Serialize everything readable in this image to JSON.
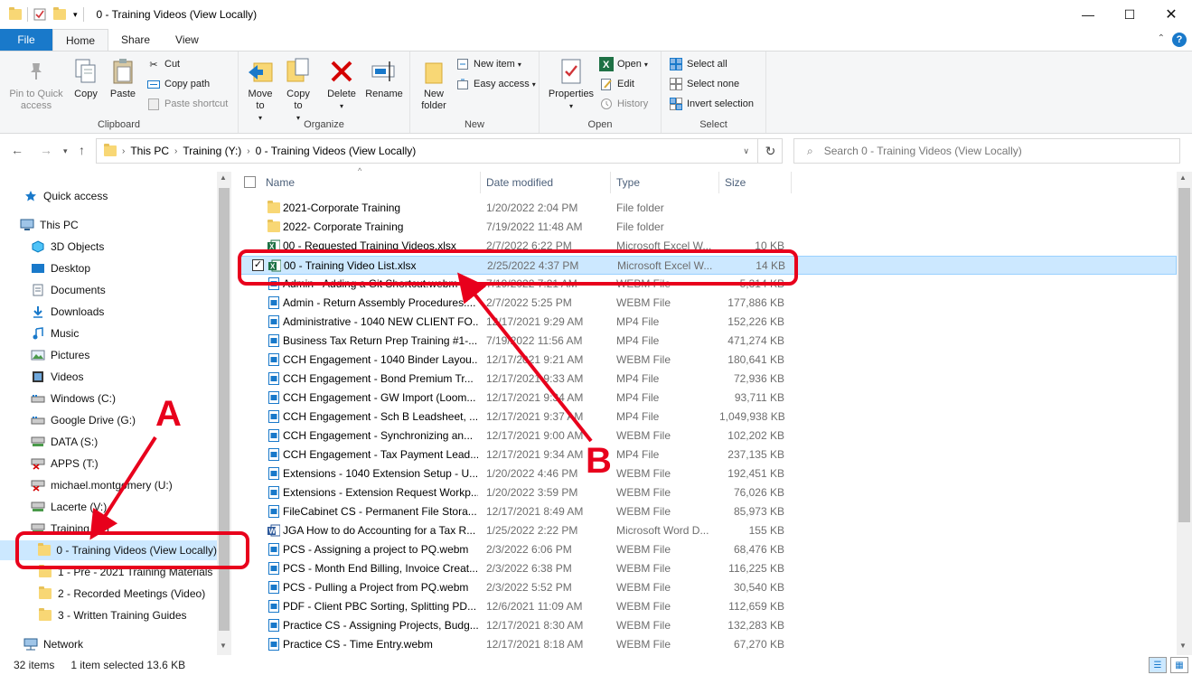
{
  "window": {
    "title": "0 - Training Videos (View Locally)",
    "minimize_icon": "minimize-icon",
    "maximize_icon": "maximize-icon",
    "close_icon": "close-icon"
  },
  "ribbon_tabs": [
    "File",
    "Home",
    "Share",
    "View"
  ],
  "ribbon": {
    "clipboard": {
      "label": "Clipboard",
      "pin": "Pin to Quick access",
      "copy": "Copy",
      "paste": "Paste",
      "cut": "Cut",
      "copy_path": "Copy path",
      "paste_shortcut": "Paste shortcut"
    },
    "organize": {
      "label": "Organize",
      "move_to": "Move to",
      "copy_to": "Copy to",
      "delete": "Delete",
      "rename": "Rename"
    },
    "new": {
      "label": "New",
      "new_folder": "New folder",
      "new_item": "New item",
      "easy_access": "Easy access"
    },
    "open": {
      "label": "Open",
      "properties": "Properties",
      "open": "Open",
      "edit": "Edit",
      "history": "History"
    },
    "select": {
      "label": "Select",
      "select_all": "Select all",
      "select_none": "Select none",
      "invert_selection": "Invert selection"
    }
  },
  "address": {
    "segments": [
      "This PC",
      "Training (Y:)",
      "0 - Training Videos (View Locally)"
    ],
    "search_placeholder": "Search 0 - Training Videos (View Locally)"
  },
  "nav": {
    "items": [
      {
        "label": "Quick access",
        "icon": "star-icon"
      },
      {
        "label": "This PC",
        "icon": "computer-icon"
      },
      {
        "label": "3D Objects",
        "icon": "cube-icon"
      },
      {
        "label": "Desktop",
        "icon": "desktop-icon"
      },
      {
        "label": "Documents",
        "icon": "documents-icon"
      },
      {
        "label": "Downloads",
        "icon": "download-icon"
      },
      {
        "label": "Music",
        "icon": "music-icon"
      },
      {
        "label": "Pictures",
        "icon": "pictures-icon"
      },
      {
        "label": "Videos",
        "icon": "videos-icon"
      },
      {
        "label": "Windows (C:)",
        "icon": "drive-icon"
      },
      {
        "label": "Google Drive (G:)",
        "icon": "drive-icon"
      },
      {
        "label": "DATA (S:)",
        "icon": "network-drive-icon"
      },
      {
        "label": "APPS (T:)",
        "icon": "network-drive-disconnected-icon"
      },
      {
        "label": "michael.montgomery (U:)",
        "icon": "network-drive-disconnected-icon"
      },
      {
        "label": "Lacerte (V:)",
        "icon": "network-drive-icon"
      },
      {
        "label": "Training (Y:)",
        "icon": "network-drive-icon"
      },
      {
        "label": "0 - Training Videos (View Locally)",
        "icon": "folder-icon"
      },
      {
        "label": "1 - Pre - 2021 Training Materials",
        "icon": "folder-icon"
      },
      {
        "label": "2 - Recorded Meetings (Video)",
        "icon": "folder-icon"
      },
      {
        "label": "3 - Written Training Guides",
        "icon": "folder-icon"
      },
      {
        "label": "Network",
        "icon": "network-icon"
      }
    ]
  },
  "columns": {
    "name": "Name",
    "date": "Date modified",
    "type": "Type",
    "size": "Size"
  },
  "files": [
    {
      "name": "2021-Corporate Training",
      "date": "1/20/2022 2:04 PM",
      "type": "File folder",
      "size": "",
      "icon": "folder-icon"
    },
    {
      "name": "2022- Corporate Training",
      "date": "7/19/2022 11:48 AM",
      "type": "File folder",
      "size": "",
      "icon": "folder-icon"
    },
    {
      "name": "00 - Requested Training Videos.xlsx",
      "date": "2/7/2022 6:22 PM",
      "type": "Microsoft Excel W...",
      "size": "10 KB",
      "icon": "excel-icon"
    },
    {
      "name": "00 - Training Video List.xlsx",
      "date": "2/25/2022 4:37 PM",
      "type": "Microsoft Excel W...",
      "size": "14 KB",
      "icon": "excel-icon",
      "selected": true
    },
    {
      "name": "Admin - Adding a Git Shortcut.webm",
      "date": "7/19/2022 7:21 AM",
      "type": "WEBM File",
      "size": "5,314 KB",
      "icon": "video-file-icon"
    },
    {
      "name": "Admin - Return Assembly Procedures....",
      "date": "2/7/2022 5:25 PM",
      "type": "WEBM File",
      "size": "177,886 KB",
      "icon": "video-file-icon"
    },
    {
      "name": "Administrative - 1040 NEW CLIENT FO...",
      "date": "12/17/2021 9:29 AM",
      "type": "MP4 File",
      "size": "152,226 KB",
      "icon": "video-file-icon"
    },
    {
      "name": "Business Tax Return Prep Training #1-...",
      "date": "7/19/2022 11:56 AM",
      "type": "MP4 File",
      "size": "471,274 KB",
      "icon": "video-file-icon"
    },
    {
      "name": "CCH Engagement - 1040 Binder Layou...",
      "date": "12/17/2021 9:21 AM",
      "type": "WEBM File",
      "size": "180,641 KB",
      "icon": "video-file-icon"
    },
    {
      "name": "CCH Engagement - Bond Premium Tr...",
      "date": "12/17/2021 9:33 AM",
      "type": "MP4 File",
      "size": "72,936 KB",
      "icon": "video-file-icon"
    },
    {
      "name": "CCH Engagement - GW Import (Loom...",
      "date": "12/17/2021 9:34 AM",
      "type": "MP4 File",
      "size": "93,711 KB",
      "icon": "video-file-icon"
    },
    {
      "name": "CCH Engagement - Sch B Leadsheet, ...",
      "date": "12/17/2021 9:37 AM",
      "type": "MP4 File",
      "size": "1,049,938 KB",
      "icon": "video-file-icon"
    },
    {
      "name": "CCH Engagement - Synchronizing an...",
      "date": "12/17/2021 9:00 AM",
      "type": "WEBM File",
      "size": "102,202 KB",
      "icon": "video-file-icon"
    },
    {
      "name": "CCH Engagement - Tax Payment Lead...",
      "date": "12/17/2021 9:34 AM",
      "type": "MP4 File",
      "size": "237,135 KB",
      "icon": "video-file-icon"
    },
    {
      "name": "Extensions - 1040 Extension Setup - U...",
      "date": "1/20/2022 4:46 PM",
      "type": "WEBM File",
      "size": "192,451 KB",
      "icon": "video-file-icon"
    },
    {
      "name": "Extensions - Extension Request Workp...",
      "date": "1/20/2022 3:59 PM",
      "type": "WEBM File",
      "size": "76,026 KB",
      "icon": "video-file-icon"
    },
    {
      "name": "FileCabinet CS - Permanent File Stora...",
      "date": "12/17/2021 8:49 AM",
      "type": "WEBM File",
      "size": "85,973 KB",
      "icon": "video-file-icon"
    },
    {
      "name": "JGA How to do Accounting for a Tax R...",
      "date": "1/25/2022 2:22 PM",
      "type": "Microsoft Word D...",
      "size": "155 KB",
      "icon": "word-icon"
    },
    {
      "name": "PCS - Assigning a project to PQ.webm",
      "date": "2/3/2022 6:06 PM",
      "type": "WEBM File",
      "size": "68,476 KB",
      "icon": "video-file-icon"
    },
    {
      "name": "PCS - Month End Billing, Invoice Creat...",
      "date": "2/3/2022 6:38 PM",
      "type": "WEBM File",
      "size": "116,225 KB",
      "icon": "video-file-icon"
    },
    {
      "name": "PCS - Pulling a Project from PQ.webm",
      "date": "2/3/2022 5:52 PM",
      "type": "WEBM File",
      "size": "30,540 KB",
      "icon": "video-file-icon"
    },
    {
      "name": "PDF - Client PBC Sorting, Splitting PD...",
      "date": "12/6/2021 11:09 AM",
      "type": "WEBM File",
      "size": "112,659 KB",
      "icon": "video-file-icon"
    },
    {
      "name": "Practice CS - Assigning Projects, Budg...",
      "date": "12/17/2021 8:30 AM",
      "type": "WEBM File",
      "size": "132,283 KB",
      "icon": "video-file-icon"
    },
    {
      "name": "Practice CS - Time Entry.webm",
      "date": "12/17/2021 8:18 AM",
      "type": "WEBM File",
      "size": "67,270 KB",
      "icon": "video-file-icon"
    }
  ],
  "status": {
    "items": "32 items",
    "selected": "1 item selected  13.6 KB"
  },
  "annotations": {
    "a": "A",
    "b": "B",
    "color": "#e8001c"
  }
}
